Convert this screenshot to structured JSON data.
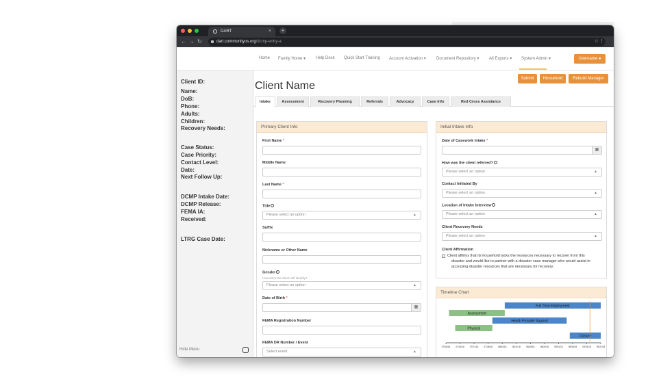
{
  "browser": {
    "tab_title": "DART",
    "url_host": "dart.communityos.org",
    "url_path": "/dcmp-entry-a"
  },
  "nav": {
    "items": [
      "Home",
      "Family Home ▾",
      "Help Desk",
      "Quick Start Training",
      "Account Activation ▾",
      "Document Repository ▾",
      "All Exports ▾",
      "System Admin ▾"
    ],
    "user_label": "Username"
  },
  "sidebar": {
    "labels": [
      "Client ID:",
      "Name:",
      "DoB:",
      "Phone:",
      "Adults:",
      "Children:",
      "Recovery Needs:",
      "Case Status:",
      "Case Priority:",
      "Contact Level:",
      "Date:",
      "Next Follow Up:",
      "DCMP Intake Date:",
      "DCMP Release:",
      "FEMA IA:",
      "Received:",
      "LTRG Case Date:"
    ],
    "hide_menu": "Hide Menu"
  },
  "page": {
    "title": "Client Name",
    "buttons": [
      "Submit",
      "Household",
      "Rebuild Manager"
    ],
    "tabs": [
      "Intake",
      "Assessment",
      "Recovery Planning",
      "Referrals",
      "Advocacy",
      "Case Info",
      "Red Cross Assistance"
    ]
  },
  "primary_panel": {
    "heading": "Primary Client Info",
    "first_name": "First Name",
    "middle_name": "Middle Name",
    "last_name": "Last Name",
    "title": "Title",
    "title_placeholder": "Please select an option",
    "suffix": "Suffix",
    "nickname": "Nickname or Other Name",
    "gender": "Gender",
    "gender_help": "How does the client self identify?",
    "gender_placeholder": "Please select an option",
    "dob": "Date of Birth",
    "fema_reg": "FEMA Registration Number",
    "fema_dr": "FEMA DR Number / Event",
    "fema_dr_placeholder": "Select event"
  },
  "intake_panel": {
    "heading": "Initial Intake Info",
    "date_intake": "Date of Casework Intake",
    "referred": "How was the client referred?",
    "referred_placeholder": "Please select an option",
    "contact_initiated": "Contact Initiated By",
    "contact_placeholder": "Please select an option",
    "location": "Location of Intake Interview",
    "location_placeholder": "Please select an option",
    "recovery_needs": "Client Recovery Needs",
    "recovery_placeholder": "Please select an option",
    "affirmation": "Client Affirmation",
    "affirmation_lines": [
      "Client affirms that its household lacks the resources necessary to recover from this",
      "disaster and would like to partner with a disaster case manager who would assist in",
      "accessing disaster resources that are necessary for recovery."
    ]
  },
  "timeline": {
    "heading": "Timeline Chart",
    "bars": [
      {
        "label": "Full Time Employment",
        "start": 0.38,
        "end": 1.0,
        "row": 0,
        "color": "#4a86c8"
      },
      {
        "label": "Assessment",
        "start": 0.02,
        "end": 0.38,
        "row": 1,
        "color": "#8cc084"
      },
      {
        "label": "Health Provider Support",
        "start": 0.3,
        "end": 0.78,
        "row": 2,
        "color": "#4a86c8"
      },
      {
        "label": "Physical",
        "start": 0.06,
        "end": 0.3,
        "row": 3,
        "color": "#8cc084"
      },
      {
        "label": "Closure",
        "start": 0.8,
        "end": 1.0,
        "row": 4,
        "color": "#4a86c8"
      }
    ],
    "ticks": [
      "07/06/18",
      "07/14/18",
      "07/21/18",
      "07/28/18",
      "08/04/18",
      "08/11/18",
      "08/18/18",
      "08/25/18",
      "09/01/18",
      "09/08/18",
      "09/15/18",
      "09/22/18"
    ]
  }
}
